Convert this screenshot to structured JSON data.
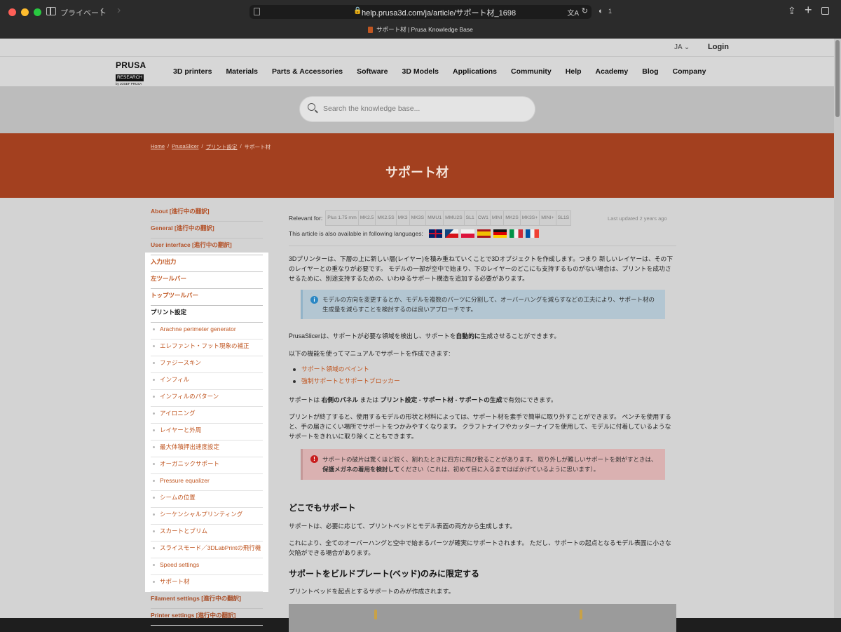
{
  "browser": {
    "private_label": "プライベート",
    "url": "help.prusa3d.com/ja/article/サポート材_1698",
    "tab_title": "サポート材 | Prusa Knowledge Base",
    "shield_count": "1"
  },
  "topbar": {
    "lang": "JA ⌄",
    "login": "Login"
  },
  "logo": {
    "line1": "PRUSA",
    "line2": "RESEARCH",
    "line3": "by JOSEF PRUSA"
  },
  "nav": [
    "3D printers",
    "Materials",
    "Parts & Accessories",
    "Software",
    "3D Models",
    "Applications",
    "Community",
    "Help",
    "Academy",
    "Blog",
    "Company"
  ],
  "search": {
    "placeholder": "Search the knowledge base..."
  },
  "breadcrumb": [
    "Home",
    "PrusaSlicer",
    "プリント設定",
    "サポート材"
  ],
  "page_title": "サポート材",
  "sidebar": {
    "top_items": [
      "About [進行中の翻訳]",
      "General [進行中の翻訳]",
      "User interface [進行中の翻訳]"
    ],
    "hl_items": [
      "入力/出力",
      "左ツールバー",
      "トップツールバー"
    ],
    "active_item": "プリント設定",
    "sub_items": [
      "Arachne perimeter generator",
      "エレファント・フット現象の補正",
      "ファジースキン",
      "インフィル",
      "インフィルのパターン",
      "アイロニング",
      "レイヤーと外周",
      "最大体積押出速度設定",
      "オーガニックサポート",
      "Pressure equalizer",
      "シームの位置",
      "シーケンシャルプリンティング",
      "スカートとブリム",
      "スライスモード／3DLabPrintの飛行機",
      "Speed settings",
      "サポート材"
    ],
    "after_items": [
      "Filament settings [進行中の翻訳]",
      "Printer settings [進行中の翻訳]"
    ]
  },
  "article": {
    "relevant_label": "Relevant for:",
    "chips": [
      "Plus 1.75 mm",
      "MK2.5",
      "MK2.5S",
      "MK3",
      "MK3S",
      "MMU1",
      "MMU2S",
      "SL1",
      "CW1",
      "MINI",
      "MK2S",
      "MK3S+",
      "MINI+",
      "SL1S"
    ],
    "updated": "Last updated 2 years ago",
    "languages_label": "This article is also available in following languages:",
    "flags": [
      "uk",
      "cz",
      "pl",
      "es",
      "de",
      "it",
      "fr"
    ],
    "intro": "3Dプリンターは、下層の上に新しい層(レイヤー)を積み重ねていくことで3Dオブジェクトを作成します。つまり 新しいレイヤーは、その下のレイヤーとの重なりが必要です。 モデルの一部が空中で始まり、下のレイヤーのどこにも支持するものがない場合は、プリントを成功させるために、別途支持するための、いわゆるサポート構造を追加する必要があります。",
    "info": "モデルの方向を変更するとか、モデルを複数のパーツに分割して、オーバーハングを減らすなどの工夫により、サポート材の生成量を減らすことを検討するのは良いアプローチです。",
    "auto_pre": "PrusaSlicerは、サポートが必要な領域を検出し、サポートを",
    "auto_bold": "自動的に",
    "auto_post": "生成させることができます。",
    "manual": "以下の機能を使ってマニュアルでサポートを作成できます:",
    "links": [
      "サポート領域のペイント",
      "強制サポートとサポートブロッカー"
    ],
    "enable_1": "サポートは ",
    "enable_b1": "右側のパネル",
    "enable_2": " または ",
    "enable_b2": "プリント設定 - サポート材 - サポートの生成",
    "enable_3": "で有効にできます。",
    "removal": "プリントが終了すると、使用するモデルの形状と材料によっては、サポート材を素手で簡単に取り外すことができます。 ペンチを使用すると、手の届きにくい場所でサポートをつかみやすくなります。 クラフトナイフやカッターナイフを使用して、モデルに付着しているようなサポートをきれいに取り除くこともできます。",
    "warn_pre": "サポートの破片は驚くほど鋭く、割れたときに四方に飛び散ることがあります。 取り外しが難しいサポートを剥がすときは、",
    "warn_bold": "保護メガネの着用を検討して",
    "warn_post": "ください（これは、初めて目に入るまではばかげているように思います）。",
    "h_everywhere": "どこでもサポート",
    "everywhere_1": "サポートは、必要に応じて、プリントベッドとモデル表面の両方から生成します。",
    "everywhere_2": "これにより、全てのオーバーハングと空中で始まるパーツが確実にサポートされます。 ただし、サポートの起点となるモデル表面に小さな欠陥ができる場合があります。",
    "h_buildplate": "サポートをビルドプレート(ベッド)のみに限定する",
    "buildplate_1": "プリントベッドを起点とするサポートのみが作成されます。"
  },
  "colors": {
    "accent": "#c05621",
    "hero": "#a3401f",
    "info_box": "#b3c6d2",
    "warn_box": "#dab1b1"
  }
}
